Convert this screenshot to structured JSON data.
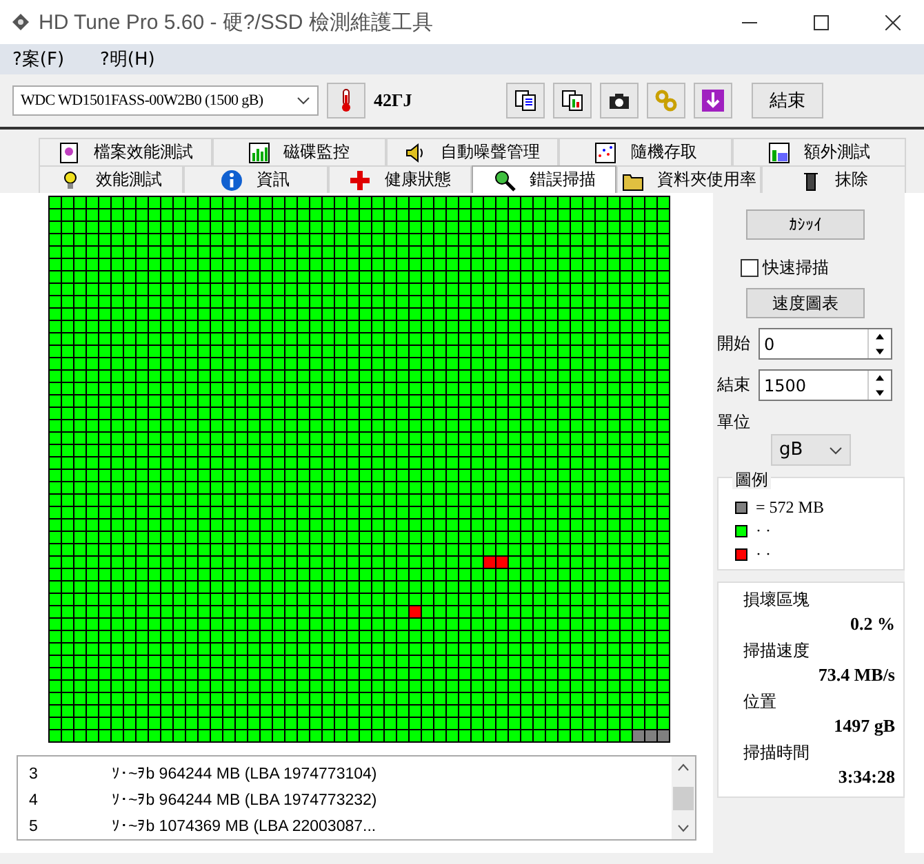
{
  "window": {
    "title": "HD Tune Pro 5.60 - 硬?/SSD 檢測維護工具"
  },
  "menu": [
    "?案(F)",
    "?明(H)"
  ],
  "toolbar": {
    "drive": "WDC WD1501FASS-00W2B0 (1500 gB)",
    "temperature": "42ΓJ",
    "exit_button": "結束"
  },
  "tab_rows": [
    [
      {
        "label": "檔案效能測試",
        "selected": false
      },
      {
        "label": "磁碟監控",
        "selected": false
      },
      {
        "label": "自動噪聲管理",
        "selected": false
      },
      {
        "label": "隨機存取",
        "selected": false
      },
      {
        "label": "額外測試",
        "selected": false
      }
    ],
    [
      {
        "label": "效能測試",
        "selected": false
      },
      {
        "label": "資訊",
        "selected": false
      },
      {
        "label": "健康狀態",
        "selected": false
      },
      {
        "label": "錯誤掃描",
        "selected": true
      },
      {
        "label": "資料夾使用率",
        "selected": false
      },
      {
        "label": "抹除",
        "selected": false
      }
    ]
  ],
  "block_map": {
    "level": 0.99864,
    "rows": [
      [
        false,
        false,
        false,
        false,
        false,
        false,
        false,
        false,
        false,
        false,
        false,
        false,
        false,
        false,
        false,
        false,
        false,
        false,
        false,
        false,
        false,
        false,
        false,
        false,
        false,
        false,
        false,
        false,
        false,
        false,
        false,
        false,
        false,
        false,
        false,
        false,
        false,
        false,
        false,
        false,
        false,
        false,
        false,
        false,
        false,
        false,
        false,
        false,
        false,
        false
      ],
      [
        false,
        false,
        false,
        false,
        false,
        false,
        false,
        false,
        false,
        false,
        false,
        false,
        false,
        false,
        false,
        false,
        false,
        false,
        false,
        false,
        false,
        false,
        false,
        false,
        false,
        false,
        false,
        false,
        false,
        false,
        false,
        false,
        false,
        false,
        false,
        false,
        false,
        false,
        false,
        false,
        false,
        false,
        false,
        false,
        false,
        false,
        false,
        false,
        false,
        false
      ],
      [
        false,
        false,
        false,
        false,
        false,
        false,
        false,
        false,
        false,
        false,
        false,
        false,
        false,
        false,
        false,
        false,
        false,
        false,
        false,
        false,
        false,
        false,
        false,
        false,
        false,
        false,
        false,
        false,
        false,
        false,
        false,
        false,
        false,
        false,
        false,
        false,
        false,
        false,
        false,
        false,
        false,
        false,
        false,
        false,
        false,
        false,
        false,
        false,
        false,
        false
      ],
      [
        false,
        false,
        false,
        false,
        false,
        false,
        false,
        false,
        false,
        false,
        false,
        false,
        false,
        false,
        false,
        false,
        false,
        false,
        false,
        false,
        false,
        false,
        false,
        false,
        false,
        false,
        false,
        false,
        false,
        false,
        false,
        false,
        false,
        false,
        false,
        false,
        false,
        false,
        false,
        false,
        false,
        false,
        false,
        false,
        false,
        false,
        false,
        false,
        false,
        false
      ],
      [
        false,
        false,
        false,
        false,
        false,
        false,
        false,
        false,
        false,
        false,
        false,
        false,
        false,
        false,
        false,
        false,
        false,
        false,
        false,
        false,
        false,
        false,
        false,
        false,
        false,
        false,
        false,
        false,
        false,
        false,
        false,
        false,
        false,
        false,
        false,
        false,
        false,
        false,
        false,
        false,
        false,
        false,
        false,
        false,
        false,
        false,
        false,
        false,
        false,
        false
      ],
      [
        false,
        false,
        false,
        false,
        false,
        false,
        false,
        false,
        false,
        false,
        false,
        false,
        false,
        false,
        false,
        false,
        false,
        false,
        false,
        false,
        false,
        false,
        false,
        false,
        false,
        false,
        false,
        false,
        false,
        false,
        false,
        false,
        false,
        false,
        false,
        false,
        false,
        false,
        false,
        false,
        false,
        false,
        false,
        false,
        false,
        false,
        false,
        false,
        false,
        false
      ],
      [
        false,
        false,
        false,
        false,
        false,
        false,
        false,
        false,
        false,
        false,
        false,
        false,
        false,
        false,
        false,
        false,
        false,
        false,
        false,
        false,
        false,
        false,
        false,
        false,
        false,
        false,
        false,
        false,
        false,
        false,
        false,
        false,
        false,
        false,
        false,
        false,
        false,
        false,
        false,
        false,
        false,
        false,
        false,
        false,
        false,
        false,
        false,
        false,
        false,
        false
      ],
      [
        false,
        false,
        false,
        false,
        false,
        false,
        false,
        false,
        false,
        false,
        false,
        false,
        false,
        false,
        false,
        false,
        false,
        false,
        false,
        false,
        false,
        false,
        false,
        false,
        false,
        false,
        false,
        false,
        false,
        false,
        false,
        false,
        false,
        false,
        false,
        false,
        false,
        false,
        false,
        false,
        false,
        false,
        false,
        false,
        false,
        false,
        false,
        false,
        false,
        false
      ],
      [
        false,
        false,
        false,
        false,
        false,
        false,
        false,
        false,
        false,
        false,
        false,
        false,
        false,
        false,
        false,
        false,
        false,
        false,
        false,
        false,
        false,
        false,
        false,
        false,
        false,
        false,
        false,
        false,
        false,
        false,
        false,
        false,
        false,
        false,
        false,
        false,
        false,
        false,
        false,
        false,
        false,
        false,
        false,
        false,
        false,
        false,
        false,
        false,
        false,
        false
      ],
      [
        false,
        false,
        false,
        false,
        false,
        false,
        false,
        false,
        false,
        false,
        false,
        false,
        false,
        false,
        false,
        false,
        false,
        false,
        false,
        false,
        false,
        false,
        false,
        false,
        false,
        false,
        false,
        false,
        false,
        false,
        false,
        false,
        false,
        false,
        false,
        false,
        false,
        false,
        false,
        false,
        false,
        false,
        false,
        false,
        false,
        false,
        false,
        false,
        false,
        false
      ],
      [
        false,
        false,
        false,
        false,
        false,
        false,
        false,
        false,
        false,
        false,
        false,
        false,
        false,
        false,
        false,
        false,
        false,
        false,
        false,
        false,
        false,
        false,
        false,
        false,
        false,
        false,
        false,
        false,
        false,
        false,
        false,
        false,
        false,
        false,
        false,
        false,
        false,
        false,
        false,
        false,
        false,
        false,
        false,
        false,
        false,
        false,
        false,
        false,
        false,
        false
      ],
      [
        false,
        false,
        false,
        false,
        false,
        false,
        false,
        false,
        false,
        false,
        false,
        false,
        false,
        false,
        false,
        false,
        false,
        false,
        false,
        false,
        false,
        false,
        false,
        false,
        false,
        false,
        false,
        false,
        false,
        false,
        false,
        false,
        false,
        false,
        false,
        false,
        false,
        false,
        false,
        false,
        false,
        false,
        false,
        false,
        false,
        false,
        false,
        false,
        false,
        false
      ],
      [
        false,
        false,
        false,
        false,
        false,
        false,
        false,
        false,
        false,
        false,
        false,
        false,
        false,
        false,
        false,
        false,
        false,
        false,
        false,
        false,
        false,
        false,
        false,
        false,
        false,
        false,
        false,
        false,
        false,
        false,
        false,
        false,
        false,
        false,
        false,
        false,
        false,
        false,
        false,
        false,
        false,
        false,
        false,
        false,
        false,
        false,
        false,
        false,
        false,
        false
      ],
      [
        false,
        false,
        false,
        false,
        false,
        false,
        false,
        false,
        false,
        false,
        false,
        false,
        false,
        false,
        false,
        false,
        false,
        false,
        false,
        false,
        false,
        false,
        false,
        false,
        false,
        false,
        false,
        false,
        false,
        false,
        false,
        false,
        false,
        false,
        false,
        false,
        false,
        false,
        false,
        false,
        false,
        false,
        false,
        false,
        false,
        false,
        false,
        false,
        false,
        false
      ],
      [
        false,
        false,
        false,
        false,
        false,
        false,
        false,
        false,
        false,
        false,
        false,
        false,
        false,
        false,
        false,
        false,
        false,
        false,
        false,
        false,
        false,
        false,
        false,
        false,
        false,
        false,
        false,
        false,
        false,
        false,
        false,
        false,
        false,
        false,
        false,
        false,
        false,
        false,
        false,
        false,
        false,
        false,
        false,
        false,
        false,
        false,
        false,
        false,
        false,
        false
      ],
      [
        false,
        false,
        false,
        false,
        false,
        false,
        false,
        false,
        false,
        false,
        false,
        false,
        false,
        false,
        false,
        false,
        false,
        false,
        false,
        false,
        false,
        false,
        false,
        false,
        false,
        false,
        false,
        false,
        false,
        false,
        false,
        false,
        false,
        false,
        false,
        false,
        false,
        false,
        false,
        false,
        false,
        false,
        false,
        false,
        false,
        false,
        false,
        false,
        false,
        false
      ],
      [
        false,
        false,
        false,
        false,
        false,
        false,
        false,
        false,
        false,
        false,
        false,
        false,
        false,
        false,
        false,
        false,
        false,
        false,
        false,
        false,
        false,
        false,
        false,
        false,
        false,
        false,
        false,
        false,
        false,
        false,
        false,
        false,
        false,
        false,
        false,
        false,
        false,
        false,
        false,
        false,
        false,
        false,
        false,
        false,
        false,
        false,
        false,
        false,
        false,
        false
      ],
      [
        false,
        false,
        false,
        false,
        false,
        false,
        false,
        false,
        false,
        false,
        false,
        false,
        false,
        false,
        false,
        false,
        false,
        false,
        false,
        false,
        false,
        false,
        false,
        false,
        false,
        false,
        false,
        false,
        false,
        false,
        false,
        false,
        false,
        false,
        false,
        false,
        false,
        false,
        false,
        false,
        false,
        false,
        false,
        false,
        false,
        false,
        false,
        false,
        false,
        false
      ],
      [
        false,
        false,
        false,
        false,
        false,
        false,
        false,
        false,
        false,
        false,
        false,
        false,
        false,
        false,
        false,
        false,
        false,
        false,
        false,
        false,
        false,
        false,
        false,
        false,
        false,
        false,
        false,
        false,
        false,
        false,
        false,
        false,
        false,
        false,
        false,
        false,
        false,
        false,
        false,
        false,
        false,
        false,
        false,
        false,
        false,
        false,
        false,
        false,
        false,
        false
      ],
      [
        false,
        false,
        false,
        false,
        false,
        false,
        false,
        false,
        false,
        false,
        false,
        false,
        false,
        false,
        false,
        false,
        false,
        false,
        false,
        false,
        false,
        false,
        false,
        false,
        false,
        false,
        false,
        false,
        false,
        false,
        false,
        false,
        false,
        false,
        false,
        false,
        false,
        false,
        false,
        false,
        false,
        false,
        false,
        false,
        false,
        false,
        false,
        false,
        false,
        false
      ],
      [
        false,
        false,
        false,
        false,
        false,
        false,
        false,
        false,
        false,
        false,
        false,
        false,
        false,
        false,
        false,
        false,
        false,
        false,
        false,
        false,
        false,
        false,
        false,
        false,
        false,
        false,
        false,
        false,
        false,
        false,
        false,
        false,
        false,
        false,
        false,
        false,
        false,
        false,
        false,
        false,
        false,
        false,
        false,
        false,
        false,
        false,
        false,
        false,
        false,
        false
      ],
      [
        false,
        false,
        false,
        false,
        false,
        false,
        false,
        false,
        false,
        false,
        false,
        false,
        false,
        false,
        false,
        false,
        false,
        false,
        false,
        false,
        false,
        false,
        false,
        false,
        false,
        false,
        false,
        false,
        false,
        false,
        false,
        false,
        false,
        false,
        false,
        false,
        false,
        false,
        false,
        false,
        false,
        false,
        false,
        false,
        false,
        false,
        false,
        false,
        false,
        false
      ],
      [
        false,
        false,
        false,
        false,
        false,
        false,
        false,
        false,
        false,
        false,
        false,
        false,
        false,
        false,
        false,
        false,
        false,
        false,
        false,
        false,
        false,
        false,
        false,
        false,
        false,
        false,
        false,
        false,
        false,
        false,
        false,
        false,
        false,
        false,
        false,
        false,
        false,
        false,
        false,
        false,
        false,
        false,
        false,
        false,
        false,
        false,
        false,
        false,
        false,
        false
      ],
      [
        false,
        false,
        false,
        false,
        false,
        false,
        false,
        false,
        false,
        false,
        false,
        false,
        false,
        false,
        false,
        false,
        false,
        false,
        false,
        false,
        false,
        false,
        false,
        false,
        false,
        false,
        false,
        false,
        false,
        false,
        false,
        false,
        false,
        false,
        false,
        false,
        false,
        false,
        false,
        false,
        false,
        false,
        false,
        false,
        false,
        false,
        false,
        false,
        false,
        false
      ],
      [
        false,
        false,
        false,
        false,
        false,
        false,
        false,
        false,
        false,
        false,
        false,
        false,
        false,
        false,
        false,
        false,
        false,
        false,
        false,
        false,
        false,
        false,
        false,
        false,
        false,
        false,
        false,
        false,
        false,
        false,
        false,
        false,
        false,
        false,
        false,
        false,
        false,
        false,
        false,
        false,
        false,
        false,
        false,
        false,
        false,
        false,
        false,
        false,
        false,
        false
      ],
      [
        false,
        false,
        false,
        false,
        false,
        false,
        false,
        false,
        false,
        false,
        false,
        false,
        false,
        false,
        false,
        false,
        false,
        false,
        false,
        false,
        false,
        false,
        false,
        false,
        false,
        false,
        false,
        false,
        false,
        false,
        false,
        false,
        false,
        false,
        false,
        false,
        false,
        false,
        false,
        false,
        false,
        false,
        false,
        false,
        false,
        false,
        false,
        false,
        false,
        false
      ],
      [
        false,
        false,
        false,
        false,
        false,
        false,
        false,
        false,
        false,
        false,
        false,
        false,
        false,
        false,
        false,
        false,
        false,
        false,
        false,
        false,
        false,
        false,
        false,
        false,
        false,
        false,
        false,
        false,
        false,
        false,
        false,
        false,
        false,
        false,
        false,
        false,
        false,
        false,
        false,
        false,
        false,
        false,
        false,
        false,
        false,
        false,
        false,
        false,
        false,
        false
      ],
      [
        false,
        false,
        false,
        false,
        false,
        false,
        false,
        false,
        false,
        false,
        false,
        false,
        false,
        false,
        false,
        false,
        false,
        false,
        false,
        false,
        false,
        false,
        false,
        false,
        false,
        false,
        false,
        false,
        false,
        false,
        false,
        false,
        false,
        false,
        false,
        false,
        false,
        false,
        false,
        false,
        false,
        false,
        false,
        false,
        false,
        false,
        false,
        false,
        false,
        false
      ],
      [
        false,
        false,
        false,
        false,
        false,
        false,
        false,
        false,
        false,
        false,
        false,
        false,
        false,
        false,
        false,
        false,
        false,
        false,
        false,
        false,
        false,
        false,
        false,
        false,
        false,
        false,
        false,
        false,
        false,
        false,
        false,
        false,
        false,
        false,
        false,
        false,
        false,
        false,
        false,
        false,
        false,
        false,
        false,
        false,
        false,
        false,
        false,
        false,
        false,
        false
      ],
      [
        false,
        false,
        false,
        false,
        false,
        false,
        false,
        false,
        false,
        false,
        false,
        false,
        false,
        false,
        false,
        false,
        false,
        false,
        false,
        false,
        false,
        false,
        false,
        false,
        false,
        false,
        false,
        false,
        false,
        false,
        false,
        false,
        false,
        false,
        false,
        true,
        true,
        false,
        false,
        false,
        false,
        false,
        false,
        false,
        false,
        false,
        false,
        false,
        false,
        false
      ],
      [
        false,
        false,
        false,
        false,
        false,
        false,
        false,
        false,
        false,
        false,
        false,
        false,
        false,
        false,
        false,
        false,
        false,
        false,
        false,
        false,
        false,
        false,
        false,
        false,
        false,
        false,
        false,
        false,
        false,
        false,
        false,
        false,
        false,
        false,
        false,
        false,
        false,
        false,
        false,
        false,
        false,
        false,
        false,
        false,
        false,
        false,
        false,
        false,
        false,
        false
      ],
      [
        false,
        false,
        false,
        false,
        false,
        false,
        false,
        false,
        false,
        false,
        false,
        false,
        false,
        false,
        false,
        false,
        false,
        false,
        false,
        false,
        false,
        false,
        false,
        false,
        false,
        false,
        false,
        false,
        false,
        false,
        false,
        false,
        false,
        false,
        false,
        false,
        false,
        false,
        false,
        false,
        false,
        false,
        false,
        false,
        false,
        false,
        false,
        false,
        false,
        false
      ],
      [
        false,
        false,
        false,
        false,
        false,
        false,
        false,
        false,
        false,
        false,
        false,
        false,
        false,
        false,
        false,
        false,
        false,
        false,
        false,
        false,
        false,
        false,
        false,
        false,
        false,
        false,
        false,
        false,
        false,
        false,
        false,
        false,
        false,
        false,
        false,
        false,
        false,
        false,
        false,
        false,
        false,
        false,
        false,
        false,
        false,
        false,
        false,
        false,
        false,
        false
      ],
      [
        false,
        false,
        false,
        false,
        false,
        false,
        false,
        false,
        false,
        false,
        false,
        false,
        false,
        false,
        false,
        false,
        false,
        false,
        false,
        false,
        false,
        false,
        false,
        false,
        false,
        false,
        false,
        false,
        false,
        true,
        false,
        false,
        false,
        false,
        false,
        false,
        false,
        false,
        false,
        false,
        false,
        false,
        false,
        false,
        false,
        false,
        false,
        false,
        false,
        false
      ],
      [
        false,
        false,
        false,
        false,
        false,
        false,
        false,
        false,
        false,
        false,
        false,
        false,
        false,
        false,
        false,
        false,
        false,
        false,
        false,
        false,
        false,
        false,
        false,
        false,
        false,
        false,
        false,
        false,
        false,
        false,
        false,
        false,
        false,
        false,
        false,
        false,
        false,
        false,
        false,
        false,
        false,
        false,
        false,
        false,
        false,
        false,
        false,
        false,
        false,
        false
      ],
      [
        false,
        false,
        false,
        false,
        false,
        false,
        false,
        false,
        false,
        false,
        false,
        false,
        false,
        false,
        false,
        false,
        false,
        false,
        false,
        false,
        false,
        false,
        false,
        false,
        false,
        false,
        false,
        false,
        false,
        false,
        false,
        false,
        false,
        false,
        false,
        false,
        false,
        false,
        false,
        false,
        false,
        false,
        false,
        false,
        false,
        false,
        false,
        false,
        false,
        false
      ],
      [
        false,
        false,
        false,
        false,
        false,
        false,
        false,
        false,
        false,
        false,
        false,
        false,
        false,
        false,
        false,
        false,
        false,
        false,
        false,
        false,
        false,
        false,
        false,
        false,
        false,
        false,
        false,
        false,
        false,
        false,
        false,
        false,
        false,
        false,
        false,
        false,
        false,
        false,
        false,
        false,
        false,
        false,
        false,
        false,
        false,
        false,
        false,
        false,
        false,
        false
      ],
      [
        false,
        false,
        false,
        false,
        false,
        false,
        false,
        false,
        false,
        false,
        false,
        false,
        false,
        false,
        false,
        false,
        false,
        false,
        false,
        false,
        false,
        false,
        false,
        false,
        false,
        false,
        false,
        false,
        false,
        false,
        false,
        false,
        false,
        false,
        false,
        false,
        false,
        false,
        false,
        false,
        false,
        false,
        false,
        false,
        false,
        false,
        false,
        false,
        false,
        false
      ],
      [
        false,
        false,
        false,
        false,
        false,
        false,
        false,
        false,
        false,
        false,
        false,
        false,
        false,
        false,
        false,
        false,
        false,
        false,
        false,
        false,
        false,
        false,
        false,
        false,
        false,
        false,
        false,
        false,
        false,
        false,
        false,
        false,
        false,
        false,
        false,
        false,
        false,
        false,
        false,
        false,
        false,
        false,
        false,
        false,
        false,
        false,
        false,
        false,
        false,
        false
      ],
      [
        false,
        false,
        false,
        false,
        false,
        false,
        false,
        false,
        false,
        false,
        false,
        false,
        false,
        false,
        false,
        false,
        false,
        false,
        false,
        false,
        false,
        false,
        false,
        false,
        false,
        false,
        false,
        false,
        false,
        false,
        false,
        false,
        false,
        false,
        false,
        false,
        false,
        false,
        false,
        false,
        false,
        false,
        false,
        false,
        false,
        false,
        false,
        false,
        false,
        false
      ],
      [
        false,
        false,
        false,
        false,
        false,
        false,
        false,
        false,
        false,
        false,
        false,
        false,
        false,
        false,
        false,
        false,
        false,
        false,
        false,
        false,
        false,
        false,
        false,
        false,
        false,
        false,
        false,
        false,
        false,
        false,
        false,
        false,
        false,
        false,
        false,
        false,
        false,
        false,
        false,
        false,
        false,
        false,
        false,
        false,
        false,
        false,
        false,
        false,
        false,
        false
      ],
      [
        false,
        false,
        false,
        false,
        false,
        false,
        false,
        false,
        false,
        false,
        false,
        false,
        false,
        false,
        false,
        false,
        false,
        false,
        false,
        false,
        false,
        false,
        false,
        false,
        false,
        false,
        false,
        false,
        false,
        false,
        false,
        false,
        false,
        false,
        false,
        false,
        false,
        false,
        false,
        false,
        false,
        false,
        false,
        false,
        false,
        false,
        false,
        false,
        false,
        false
      ],
      [
        false,
        false,
        false,
        false,
        false,
        false,
        false,
        false,
        false,
        false,
        false,
        false,
        false,
        false,
        false,
        false,
        false,
        false,
        false,
        false,
        false,
        false,
        false,
        false,
        false,
        false,
        false,
        false,
        false,
        false,
        false,
        false,
        false,
        false,
        false,
        false,
        false,
        false,
        false,
        false,
        false,
        false,
        false,
        false,
        false,
        false,
        false,
        false,
        false,
        false
      ],
      [
        false,
        false,
        false,
        false,
        false,
        false,
        false,
        false,
        false,
        false,
        false,
        false,
        false,
        false,
        false,
        false,
        false,
        false,
        false,
        false,
        false,
        false,
        false,
        false,
        false,
        false,
        false,
        false,
        false,
        false,
        false,
        false,
        false,
        false,
        false,
        false,
        false,
        false,
        false,
        false,
        false,
        false,
        false,
        false,
        false,
        false,
        false,
        false,
        false,
        false
      ]
    ]
  },
  "results": [
    {
      "number": "3",
      "text": "ｿ･~ｦb 964244 MB (LBA 1974773104)"
    },
    {
      "number": "4",
      "text": "ｿ･~ｦb 964244 MB (LBA 1974773232)"
    },
    {
      "number": "5",
      "text": "ｿ･~ｦb 1074369 MB (LBA 22003087..."
    }
  ],
  "controls": {
    "start_button": "ｶｼｯｲ",
    "quick_scan": {
      "label": "快速掃描",
      "checked": false
    },
    "speed_chart_button": "速度圖表",
    "start": {
      "label": "開始",
      "value": "0"
    },
    "end": {
      "label": "結束",
      "value": "1500"
    },
    "unit": {
      "label": "單位",
      "value": "gB"
    }
  },
  "legend": {
    "title": "圖例",
    "items": [
      {
        "color": "#808080",
        "label": "= 572 MB"
      },
      {
        "color": "#00ff00",
        "label": "· ·"
      },
      {
        "color": "#ff0000",
        "label": "· ·"
      }
    ]
  },
  "stats": [
    {
      "label": "損壞區塊",
      "value": "0.2 %"
    },
    {
      "label": "掃描速度",
      "value": "73.4 MB/s"
    },
    {
      "label": "位置",
      "value": "1497 gB"
    },
    {
      "label": "掃描時間",
      "value": "3:34:28"
    }
  ]
}
